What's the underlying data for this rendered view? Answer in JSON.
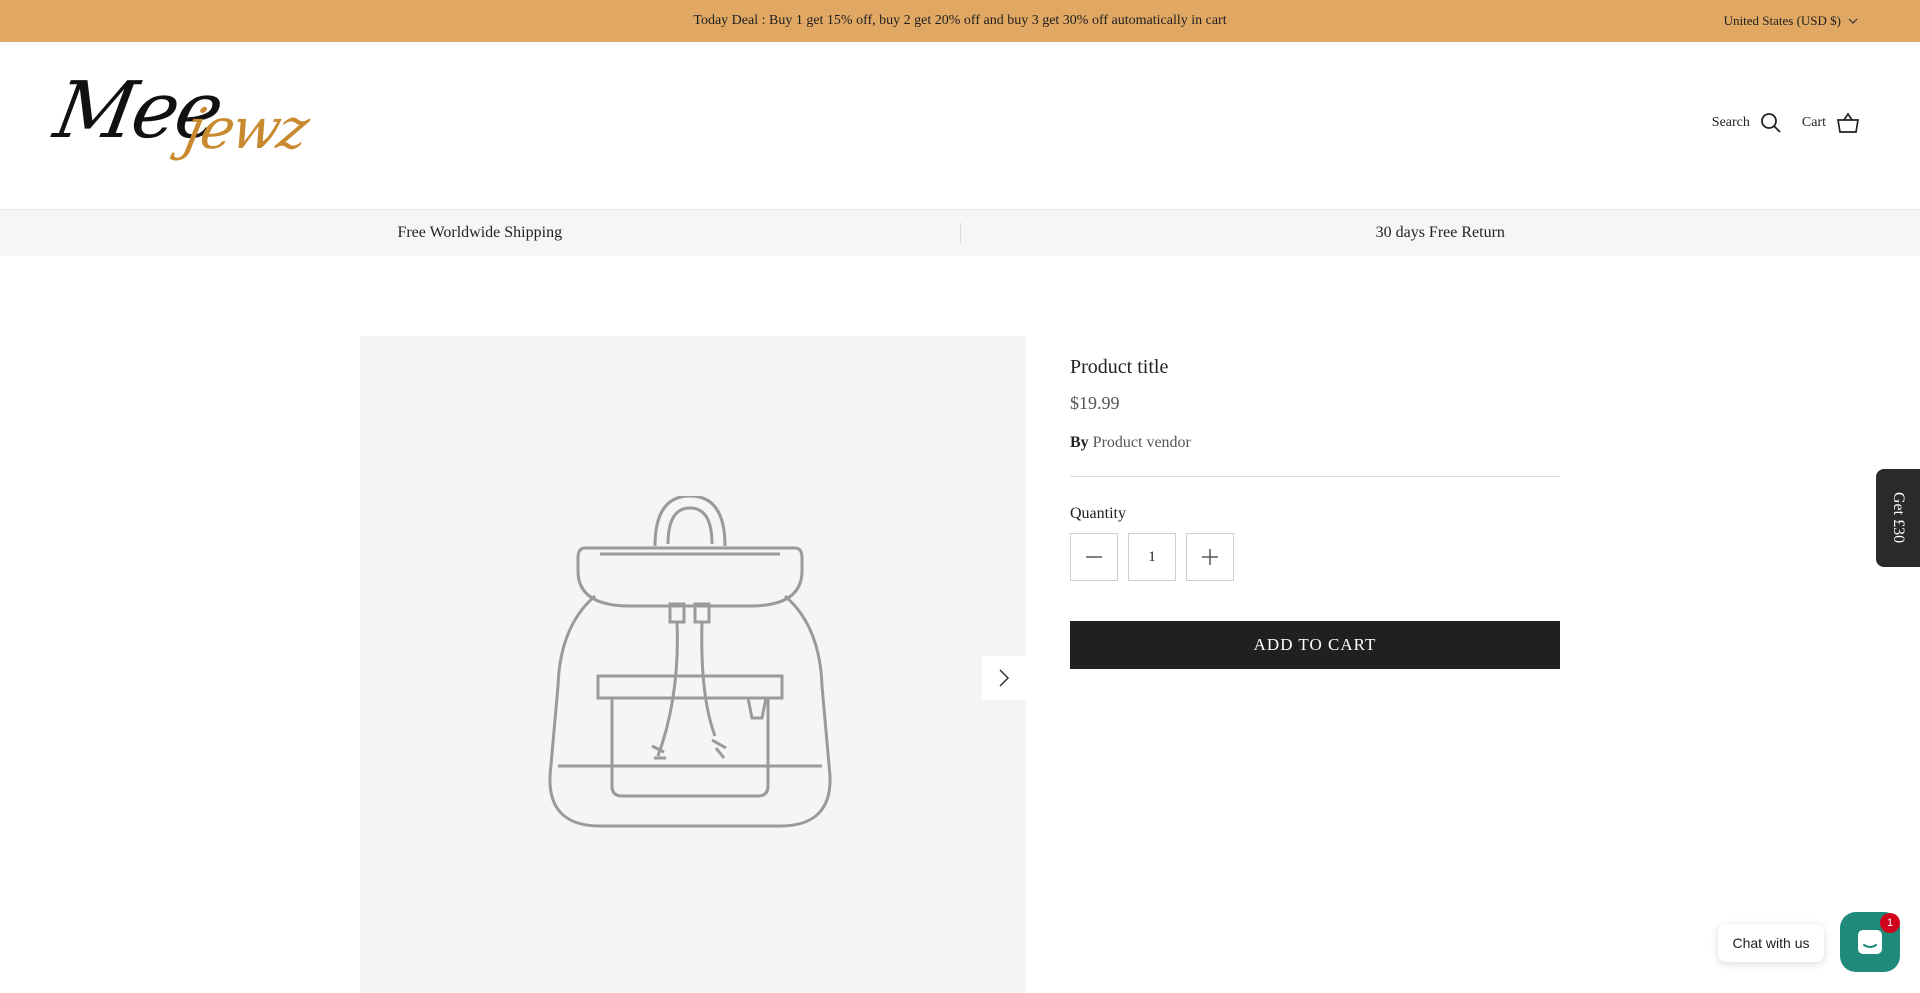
{
  "announcement": {
    "text": "Today Deal : Buy 1 get 15% off, buy 2 get 20% off and buy 3 get 30% off automatically in cart",
    "currency": "United States (USD $)"
  },
  "header": {
    "logo_main": "Mee",
    "logo_accent": "jewz",
    "search_label": "Search",
    "cart_label": "Cart"
  },
  "usp": {
    "left": "Free Worldwide Shipping",
    "right": "30 days Free Return"
  },
  "product": {
    "title": "Product title",
    "price": "$19.99",
    "vendor_prefix": "By",
    "vendor": "Product vendor",
    "quantity_label": "Quantity",
    "quantity_value": "1",
    "add_to_cart": "ADD TO CART"
  },
  "side_tab": {
    "label": "Get £30"
  },
  "chat": {
    "label": "Chat with us",
    "badge": "1"
  },
  "colors": {
    "announce_bg": "#e0a863",
    "logo_accent": "#c8892f",
    "button_bg": "#202020",
    "chat_bg": "#1f8a7a",
    "badge_bg": "#d0021b"
  },
  "icons": {
    "search": "search-icon",
    "cart": "basket-icon",
    "chevron": "chevron-down-icon",
    "next": "chevron-right-icon",
    "minus": "minus-icon",
    "plus": "plus-icon",
    "chat": "chat-icon"
  }
}
